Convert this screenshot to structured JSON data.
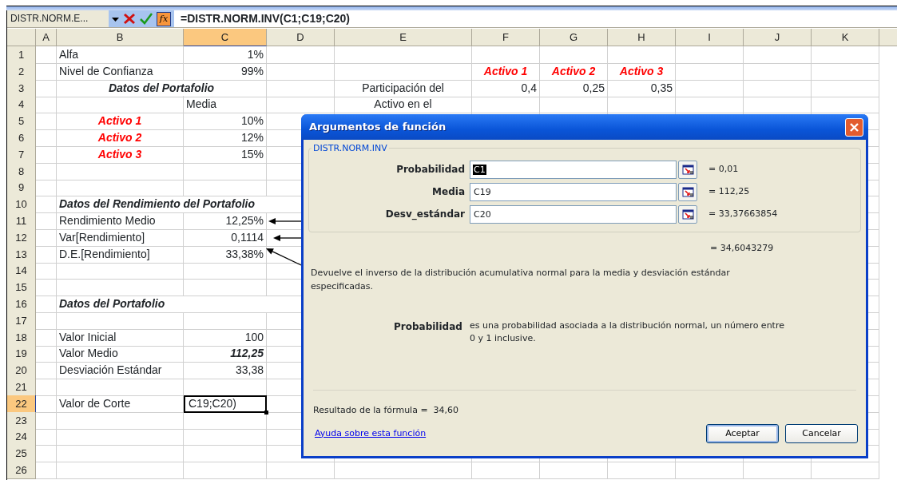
{
  "formula_bar": {
    "name_box": "DISTR.NORM.E...",
    "insert_function": "fx",
    "formula": "=DISTR.NORM.INV(C1;C19;C20)"
  },
  "columns": [
    {
      "label": "A",
      "selected": false
    },
    {
      "label": "B",
      "selected": false
    },
    {
      "label": "C",
      "selected": true
    },
    {
      "label": "D",
      "selected": false
    },
    {
      "label": "E",
      "selected": false
    },
    {
      "label": "F",
      "selected": false
    },
    {
      "label": "G",
      "selected": false
    },
    {
      "label": "H",
      "selected": false
    },
    {
      "label": "I",
      "selected": false
    },
    {
      "label": "J",
      "selected": false
    },
    {
      "label": "K",
      "selected": false
    }
  ],
  "rows": [
    {
      "label": "1",
      "selected": false,
      "b": "Alfa",
      "c": "1%"
    },
    {
      "label": "2",
      "selected": false,
      "b": "Nivel de Confianza",
      "c": "99%",
      "f": {
        "text": "Activo 1",
        "kind": "asset"
      },
      "g": {
        "text": "Activo 2",
        "kind": "asset"
      },
      "h": {
        "text": "Activo 3",
        "kind": "asset"
      }
    },
    {
      "label": "3",
      "selected": false,
      "b": {
        "text": "Datos del Portafolio",
        "kind": "title"
      },
      "e": "Participación del",
      "f": "0,4",
      "g": "0,25",
      "h": "0,35"
    },
    {
      "label": "4",
      "selected": false,
      "c": {
        "text": "Media",
        "kind": "label"
      },
      "e": "Activo en el"
    },
    {
      "label": "5",
      "selected": false,
      "b": {
        "text": "Activo 1",
        "kind": "asset"
      },
      "c": "10%"
    },
    {
      "label": "6",
      "selected": false,
      "b": {
        "text": "Activo 2",
        "kind": "asset"
      },
      "c": "12%"
    },
    {
      "label": "7",
      "selected": false,
      "b": {
        "text": "Activo 3",
        "kind": "asset"
      },
      "c": "15%"
    },
    {
      "label": "8",
      "selected": false
    },
    {
      "label": "9",
      "selected": false
    },
    {
      "label": "10",
      "selected": false,
      "b": {
        "text": "Datos del Rendimiento del Portafolio",
        "kind": "heading"
      }
    },
    {
      "label": "11",
      "selected": false,
      "b": "Rendimiento Medio",
      "c": "12,25%"
    },
    {
      "label": "12",
      "selected": false,
      "b": "Var[Rendimiento]",
      "c": "0,1114"
    },
    {
      "label": "13",
      "selected": false,
      "b": "D.E.[Rendimiento]",
      "c": "33,38%"
    },
    {
      "label": "14",
      "selected": false
    },
    {
      "label": "15",
      "selected": false
    },
    {
      "label": "16",
      "selected": false,
      "b": {
        "text": "Datos del Portafolio",
        "kind": "heading"
      }
    },
    {
      "label": "17",
      "selected": false
    },
    {
      "label": "18",
      "selected": false,
      "b": "Valor Inicial",
      "c": "100"
    },
    {
      "label": "19",
      "selected": false,
      "b": "Valor Medio",
      "c": {
        "text": "112,25",
        "kind": "emphasis"
      }
    },
    {
      "label": "20",
      "selected": false,
      "b": "Desviación Estándar",
      "c": "33,38"
    },
    {
      "label": "21",
      "selected": false
    },
    {
      "label": "22",
      "selected": true,
      "b": "Valor de Corte",
      "c": {
        "text": "C19;C20)",
        "kind": "editing"
      }
    },
    {
      "label": "23",
      "selected": false
    },
    {
      "label": "24",
      "selected": false
    },
    {
      "label": "25",
      "selected": false
    },
    {
      "label": "26",
      "selected": false
    }
  ],
  "dialog": {
    "title": "Argumentos de función",
    "function_name": "DISTR.NORM.INV",
    "arguments": [
      {
        "label": "Probabilidad",
        "value": "C1",
        "result": "= 0,01",
        "selected": true
      },
      {
        "label": "Media",
        "value": "C19",
        "result": "= 112,25",
        "selected": false
      },
      {
        "label": "Desv_estándar",
        "value": "C20",
        "result": "= 33,37663854",
        "selected": false
      }
    ],
    "formula_value": "= 34,6043279",
    "description": "Devuelve el inverso de la distribución acumulativa normal para la media y desviación estándar especificadas.",
    "argument_help": {
      "label": "Probabilidad",
      "text": "es una probabilidad asociada a la distribución normal, un número entre 0 y 1 inclusive."
    },
    "result_label": "Resultado de la fórmula =",
    "result": "34,60",
    "help_link": "Ayuda sobre esta función",
    "buttons": [
      {
        "label": "Aceptar",
        "selected": true
      },
      {
        "label": "Cancelar",
        "selected": false
      }
    ]
  }
}
